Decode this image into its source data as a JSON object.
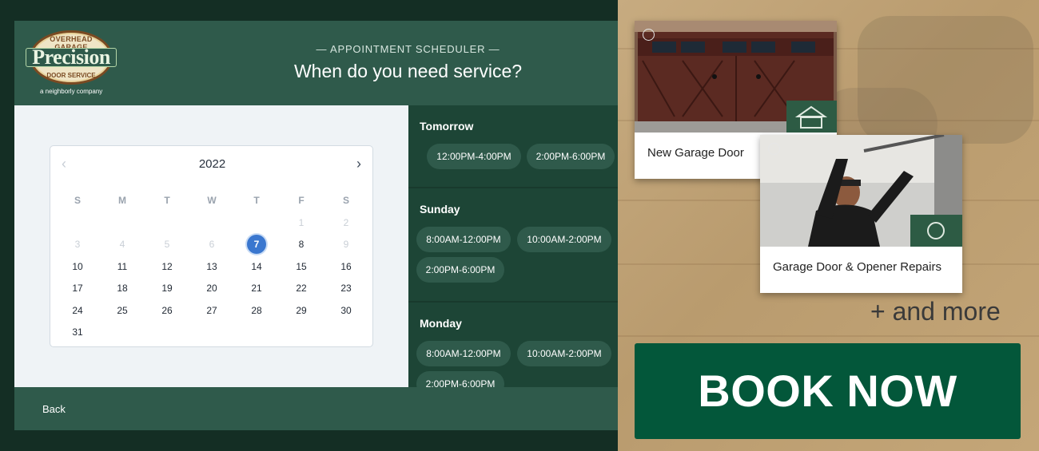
{
  "logo": {
    "top_text": "OVERHEAD GARAGE",
    "brand": "Precision",
    "bottom_text": "DOOR SERVICE",
    "company": "a neighborly company"
  },
  "header": {
    "eyebrow": "— APPOINTMENT SCHEDULER —",
    "title": "When do you need service?"
  },
  "calendar": {
    "year": "2022",
    "prev_icon": "chevron-left-icon",
    "next_icon": "chevron-right-icon",
    "weekdays": [
      "S",
      "M",
      "T",
      "W",
      "T",
      "F",
      "S"
    ],
    "days": [
      {
        "label": "",
        "state": "blank"
      },
      {
        "label": "",
        "state": "blank"
      },
      {
        "label": "",
        "state": "blank"
      },
      {
        "label": "",
        "state": "blank"
      },
      {
        "label": "",
        "state": "blank"
      },
      {
        "label": "1",
        "state": "muted"
      },
      {
        "label": "2",
        "state": "muted"
      },
      {
        "label": "3",
        "state": "muted"
      },
      {
        "label": "4",
        "state": "muted"
      },
      {
        "label": "5",
        "state": "muted"
      },
      {
        "label": "6",
        "state": "muted"
      },
      {
        "label": "7",
        "state": "selected"
      },
      {
        "label": "8",
        "state": "normal"
      },
      {
        "label": "9",
        "state": "muted"
      },
      {
        "label": "10",
        "state": "normal"
      },
      {
        "label": "11",
        "state": "normal"
      },
      {
        "label": "12",
        "state": "normal"
      },
      {
        "label": "13",
        "state": "normal"
      },
      {
        "label": "14",
        "state": "normal"
      },
      {
        "label": "15",
        "state": "normal"
      },
      {
        "label": "16",
        "state": "normal"
      },
      {
        "label": "17",
        "state": "normal"
      },
      {
        "label": "18",
        "state": "normal"
      },
      {
        "label": "19",
        "state": "normal"
      },
      {
        "label": "20",
        "state": "normal"
      },
      {
        "label": "21",
        "state": "normal"
      },
      {
        "label": "22",
        "state": "normal"
      },
      {
        "label": "23",
        "state": "normal"
      },
      {
        "label": "24",
        "state": "normal"
      },
      {
        "label": "25",
        "state": "normal"
      },
      {
        "label": "26",
        "state": "normal"
      },
      {
        "label": "27",
        "state": "normal"
      },
      {
        "label": "28",
        "state": "normal"
      },
      {
        "label": "29",
        "state": "normal"
      },
      {
        "label": "30",
        "state": "normal"
      },
      {
        "label": "31",
        "state": "normal"
      }
    ]
  },
  "schedule": [
    {
      "day": "Tomorrow",
      "slots": [
        "12:00PM-4:00PM",
        "2:00PM-6:00PM"
      ]
    },
    {
      "day": "Sunday",
      "slots": [
        "8:00AM-12:00PM",
        "10:00AM-2:00PM",
        "2:00PM-6:00PM"
      ]
    },
    {
      "day": "Monday",
      "slots": [
        "8:00AM-12:00PM",
        "10:00AM-2:00PM",
        "2:00PM-6:00PM"
      ]
    }
  ],
  "footer": {
    "back_label": "Back"
  },
  "promo": {
    "card1_label": "New Garage Door",
    "card2_label": "Garage Door & Opener Repairs",
    "more_text": "+ and more",
    "book_label": "BOOK NOW",
    "accent": "#03573a"
  }
}
